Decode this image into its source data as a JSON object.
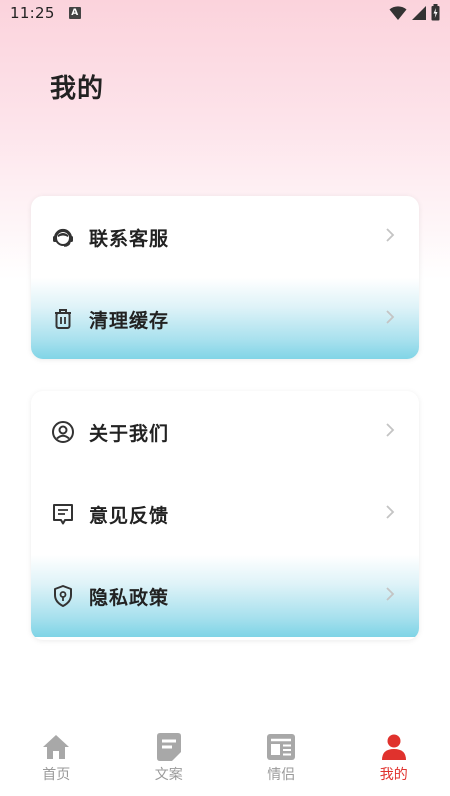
{
  "status_bar": {
    "time": "11:25",
    "notification_badge": "A"
  },
  "page": {
    "title": "我的"
  },
  "card1": {
    "items": [
      {
        "label": "联系客服",
        "icon": "headset-icon"
      },
      {
        "label": "清理缓存",
        "icon": "trash-icon"
      }
    ]
  },
  "card2": {
    "items": [
      {
        "label": "关于我们",
        "icon": "user-circle-icon"
      },
      {
        "label": "意见反馈",
        "icon": "feedback-icon"
      },
      {
        "label": "隐私政策",
        "icon": "shield-icon"
      }
    ]
  },
  "tabbar": {
    "tabs": [
      {
        "label": "首页",
        "icon": "home-icon",
        "active": false
      },
      {
        "label": "文案",
        "icon": "document-icon",
        "active": false
      },
      {
        "label": "情侣",
        "icon": "news-icon",
        "active": false
      },
      {
        "label": "我的",
        "icon": "person-icon",
        "active": true
      }
    ]
  },
  "colors": {
    "accent": "#e0322d",
    "inactive": "#9a9a9a",
    "highlight": "#7fd4e6"
  }
}
